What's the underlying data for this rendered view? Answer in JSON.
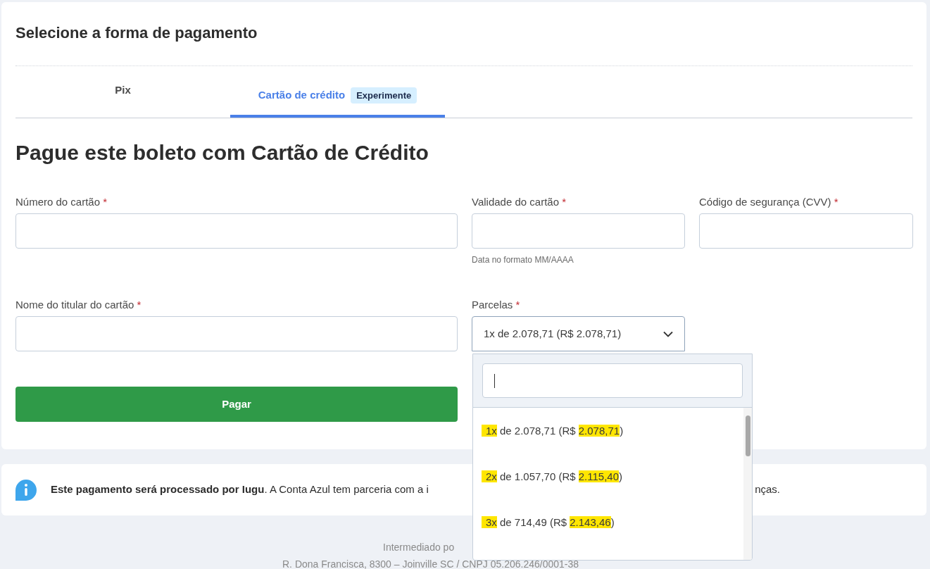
{
  "title": "Selecione a forma de pagamento",
  "tabs": [
    {
      "label": "Pix",
      "selected": false
    },
    {
      "label": "Cartão de crédito",
      "badge": "Experimente",
      "selected": true
    }
  ],
  "heading": "Pague este boleto com Cartão de Crédito",
  "fields": [
    {
      "label": "Número do cartão",
      "required_mark": "*",
      "kind": "text"
    },
    {
      "label": "Validade do cartão",
      "required_mark": "*",
      "kind": "text",
      "hint": "Data no formato MM/AAAA"
    },
    {
      "label": "Código de segurança (CVV)",
      "required_mark": "*",
      "kind": "text"
    },
    {
      "label": "Nome do titular do cartão",
      "required_mark": "*",
      "kind": "text"
    },
    {
      "label": "Parcelas",
      "required_mark": "*",
      "kind": "select",
      "value": "1x de 2.078,71 (R$ 2.078,71)",
      "expanded": true
    }
  ],
  "pay_button": "Pagar",
  "dropdown": {
    "options": [
      {
        "count": "1x",
        "middle": "de 2.078,71 (R$",
        "total": "2.078,71",
        "end": ")",
        "highlighted": true
      },
      {
        "count": "2x",
        "middle": "de 1.057,70 (R$",
        "total": "2.115,40",
        "end": ")",
        "highlighted": true
      },
      {
        "count": "3x",
        "middle": "de 714,49 (R$",
        "total": "2.143,46",
        "end": ")",
        "highlighted": true
      }
    ]
  },
  "info": {
    "text_left": "**Este pagamento será processado por Iugu**. A Conta Azul tem parceria com a i",
    "text_right": "nças."
  },
  "footer": [
    "Intermediado po",
    "R. Dona Francisca, 8300 – Joinville SC / CNPJ 05.206.246/0001-38"
  ]
}
